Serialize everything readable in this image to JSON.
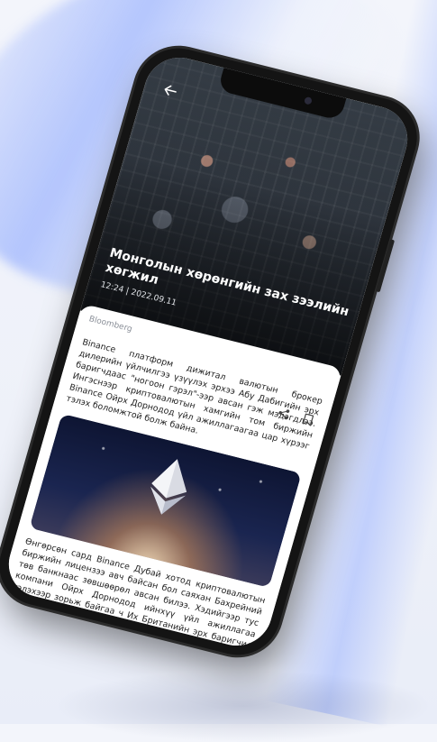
{
  "article": {
    "title": "Монголын хөрөнгийн зах зээлийн хөгжил",
    "date": "12:24 | 2022.09.11",
    "source": "Bloomberg",
    "paragraph1": "Binance платформ дижитал валютын брокер дилерийн үйлчилгээ үзүүлэх эрхээ Абу Дабигийн эрх баригчдаас \"ногоон гэрэл\"-ээр авсан гэж мэдэгдлээ. Ингэснээр криптовалютын хамгийн том биржийн Binance Ойрх Дорнодод үйл ажиллагаагаа цар хүрээг тэлэх боломжтой болж байна.",
    "paragraph2": "Өнгөрсөн сард Binance Дубай хотод криптовалютын биржийн лицензээ авч байсан бол саяхан Бахрейний төв банкнаас зөвшөөрөл авсан билээ. Хэдийгээр тус компани Ойрх Дорнодод ийнхүү үйл ажиллагаа тэлэхээр зорьж байгаа ч Их Британийн эрх баригчид хязгаарлалт тогтоосон."
  },
  "icons": {
    "back": "arrow-left-icon",
    "share": "share-icon",
    "bookmark": "bookmark-icon"
  }
}
